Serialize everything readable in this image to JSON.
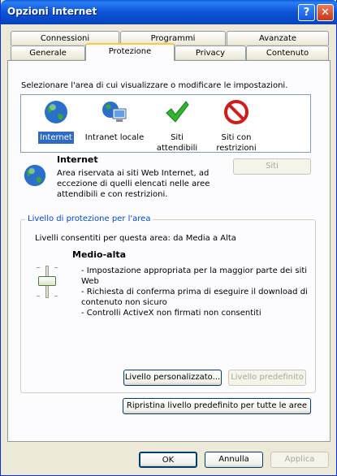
{
  "window": {
    "title": "Opzioni Internet"
  },
  "tabs_row1": [
    "Connessioni",
    "Programmi",
    "Avanzate"
  ],
  "tabs_row2": [
    "Generale",
    "Protezione",
    "Privacy",
    "Contenuto"
  ],
  "instruction": "Selezionare l'area di cui visualizzare o modificare le impostazioni.",
  "zones": [
    {
      "label": "Internet",
      "icon": "globe-icon",
      "selected": true
    },
    {
      "label": "Intranet locale",
      "icon": "intranet-icon",
      "selected": false
    },
    {
      "label": "Siti attendibili",
      "icon": "checkmark-icon",
      "selected": false
    },
    {
      "label": "Siti con restrizioni",
      "icon": "restricted-icon",
      "selected": false
    }
  ],
  "zone_info": {
    "title": "Internet",
    "desc_1": "Area riservata ai siti Web Internet, ad",
    "desc_2": "eccezione di quelli elencati nelle aree",
    "desc_3": "attendibili e con restrizioni.",
    "sites_button": "Siti"
  },
  "security": {
    "group_title": "Livello di protezione per l'area",
    "allowed": "Livelli consentiti per questa area: da Media a Alta",
    "level_name": "Medio-alta",
    "level_fraction": 0.5,
    "bullets": [
      "- Impostazione appropriata per la maggior parte dei siti",
      "Web",
      "- Richiesta di conferma prima di eseguire il download di",
      "contenuto non sicuro",
      "- Controlli ActiveX non firmati non consentiti"
    ],
    "custom_button": "Livello personalizzato...",
    "default_button": "Livello predefinito",
    "reset_all_button": "Ripristina livello predefinito per tutte le aree"
  },
  "footer": {
    "ok": "OK",
    "cancel": "Annulla",
    "apply": "Applica"
  },
  "colors": {
    "titlebar": "#0a5bd8",
    "selection": "#316ac5",
    "group_title": "#0046d5"
  }
}
